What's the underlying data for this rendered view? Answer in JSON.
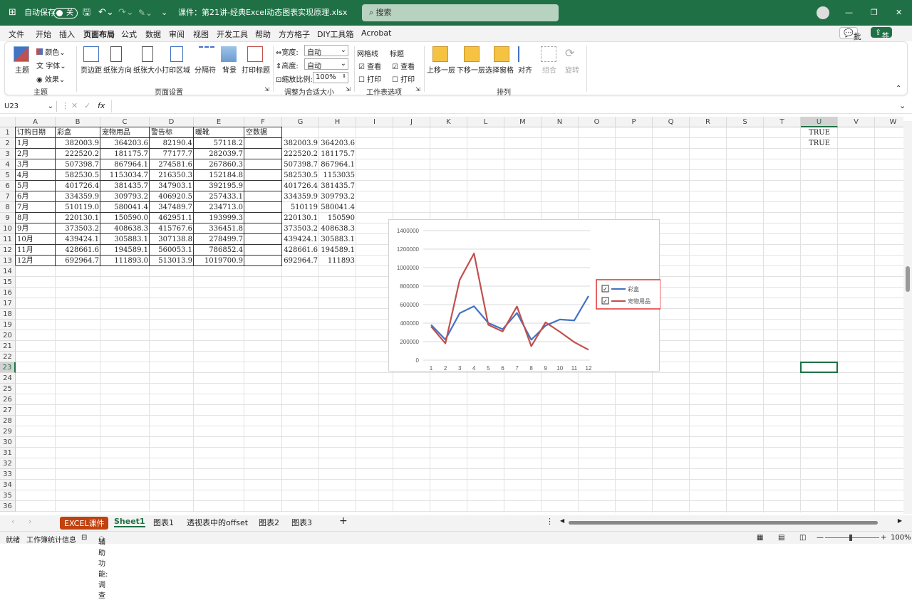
{
  "titlebar": {
    "autosave_label": "自动保存",
    "autosave_state": "关",
    "filename": "课件：第21讲-经典Excel动态图表实现原理.xlsx",
    "search_placeholder": "搜索"
  },
  "menu": [
    "文件",
    "开始",
    "插入",
    "页面布局",
    "公式",
    "数据",
    "审阅",
    "视图",
    "开发工具",
    "帮助",
    "方方格子",
    "DIY工具箱",
    "Acrobat"
  ],
  "menu_active": "页面布局",
  "actions": {
    "comment": "批注",
    "share": "共享"
  },
  "ribbon": {
    "theme": "主题",
    "colors": "颜色",
    "fonts": "字体",
    "effects": "效果",
    "group_theme": "主题",
    "margins": "页边距",
    "orientation": "纸张方向",
    "size": "纸张大小",
    "print_area": "打印区域",
    "breaks": "分隔符",
    "background": "背景",
    "print_titles": "打印标题",
    "group_page_setup": "页面设置",
    "width_label": "宽度:",
    "width_value": "自动",
    "height_label": "高度:",
    "height_value": "自动",
    "scale_label": "缩放比例:",
    "scale_value": "100%",
    "group_fit": "调整为合适大小",
    "gridlines": "网格线",
    "headings": "标题",
    "view": "查看",
    "print": "打印",
    "group_sheet_options": "工作表选项",
    "bring_forward": "上移一层",
    "send_backward": "下移一层",
    "selection_pane": "选择窗格",
    "align": "对齐",
    "group_btn": "组合",
    "rotate": "旋转",
    "group_arrange": "排列"
  },
  "formula_bar": {
    "namebox": "U23",
    "fx": "fx",
    "content": ""
  },
  "columns": [
    "A",
    "B",
    "C",
    "D",
    "E",
    "F",
    "G",
    "H",
    "I",
    "J",
    "K",
    "L",
    "M",
    "N",
    "O",
    "P",
    "Q",
    "R",
    "S",
    "T",
    "U",
    "V",
    "W"
  ],
  "header_row": [
    "订购日期",
    "彩盒",
    "宠物用品",
    "警告标",
    "暖靴",
    "空数据"
  ],
  "rows": [
    [
      "1月",
      "382003.9",
      "364203.6",
      "82190.4",
      "57118.2",
      "",
      "382003.9",
      "364203.6"
    ],
    [
      "2月",
      "222520.2",
      "181175.7",
      "77177.7",
      "282039.7",
      "",
      "222520.2",
      "181175.7"
    ],
    [
      "3月",
      "507398.7",
      "867964.1",
      "274581.6",
      "267860.3",
      "",
      "507398.7",
      "867964.1"
    ],
    [
      "4月",
      "582530.5",
      "1153034.7",
      "216350.3",
      "152184.8",
      "",
      "582530.5",
      "1153035"
    ],
    [
      "5月",
      "401726.4",
      "381435.7",
      "347903.1",
      "392195.9",
      "",
      "401726.4",
      "381435.7"
    ],
    [
      "6月",
      "334359.9",
      "309793.2",
      "406920.5",
      "257433.1",
      "",
      "334359.9",
      "309793.2"
    ],
    [
      "7月",
      "510119.0",
      "580041.4",
      "347489.7",
      "234713.0",
      "",
      "510119",
      "580041.4"
    ],
    [
      "8月",
      "220130.1",
      "150590.0",
      "462951.1",
      "193999.3",
      "",
      "220130.1",
      "150590"
    ],
    [
      "9月",
      "373503.2",
      "408638.3",
      "415767.6",
      "336451.8",
      "",
      "373503.2",
      "408638.3"
    ],
    [
      "10月",
      "439424.1",
      "305883.1",
      "307138.8",
      "278499.7",
      "",
      "439424.1",
      "305883.1"
    ],
    [
      "11月",
      "428661.6",
      "194589.1",
      "560053.1",
      "786852.4",
      "",
      "428661.6",
      "194589.1"
    ],
    [
      "12月",
      "692964.7",
      "111893.0",
      "513013.9",
      "1019700.9",
      "",
      "692964.7",
      "111893"
    ]
  ],
  "u_column": [
    "TRUE",
    "TRUE"
  ],
  "chart_data": {
    "type": "line",
    "title": "",
    "x": [
      1,
      2,
      3,
      4,
      5,
      6,
      7,
      8,
      9,
      10,
      11,
      12
    ],
    "ylim": [
      0,
      1400000
    ],
    "yticks": [
      0,
      200000,
      400000,
      600000,
      800000,
      1000000,
      1200000,
      1400000
    ],
    "series": [
      {
        "name": "彩盒",
        "color": "#4472c4",
        "values": [
          382003.9,
          222520.2,
          507398.7,
          582530.5,
          401726.4,
          334359.9,
          510119,
          220130.1,
          373503.2,
          439424.1,
          428661.6,
          692964.7
        ]
      },
      {
        "name": "宠物用品",
        "color": "#c0504d",
        "values": [
          364203.6,
          181175.7,
          867964.1,
          1153034.7,
          381435.7,
          309793.2,
          580041.4,
          150590,
          408638.3,
          305883.1,
          194589.1,
          111893
        ]
      }
    ],
    "legend": "right"
  },
  "sheets": [
    "EXCEL课件",
    "Sheet1",
    "图表1",
    "透视表中的offset",
    "图表2",
    "图表3"
  ],
  "active_sheet": "Sheet1",
  "status": {
    "ready": "就绪",
    "stats": "工作簿统计信息",
    "accessibility": "辅助功能: 调查",
    "zoom": "100%"
  }
}
